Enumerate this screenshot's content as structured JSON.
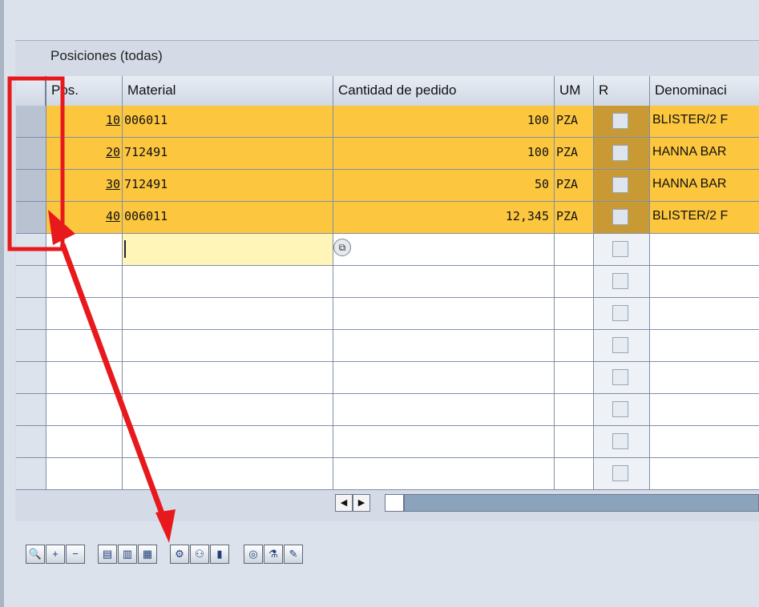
{
  "panel": {
    "title": "Posiciones (todas)"
  },
  "grid": {
    "headers": {
      "pos": "Pos.",
      "material": "Material",
      "quantity": "Cantidad de pedido",
      "um": "UM",
      "r": "R",
      "denomination": "Denominaci"
    },
    "rows": [
      {
        "pos": "10",
        "material": "006011",
        "quantity": "100",
        "um": "PZA",
        "denomination": "BLISTER/2 F"
      },
      {
        "pos": "20",
        "material": "712491",
        "quantity": "100",
        "um": "PZA",
        "denomination": "HANNA BAR"
      },
      {
        "pos": "30",
        "material": "712491",
        "quantity": "50",
        "um": "PZA",
        "denomination": "HANNA BAR"
      },
      {
        "pos": "40",
        "material": "006011",
        "quantity": "12,345",
        "um": "PZA",
        "denomination": "BLISTER/2 F"
      }
    ],
    "empty_rows": 8,
    "f4_icon": "value-help-icon"
  },
  "scrollbar": {
    "left_arrow": "◀",
    "right_arrow": "▶"
  },
  "toolbar": {
    "buttons": [
      {
        "name": "details-icon",
        "glyph": "🔍"
      },
      {
        "name": "insert-row-icon",
        "glyph": "+"
      },
      {
        "name": "delete-row-icon",
        "glyph": "−"
      },
      {
        "name": "select-all-icon",
        "glyph": "▤"
      },
      {
        "name": "select-block-icon",
        "glyph": "▥"
      },
      {
        "name": "deselect-all-icon",
        "glyph": "▦"
      },
      {
        "name": "default-values-icon",
        "glyph": "⚙"
      },
      {
        "name": "copy-icon",
        "glyph": "⚇"
      },
      {
        "name": "conditions-icon",
        "glyph": "▮"
      },
      {
        "name": "change-all-icon",
        "glyph": "◎"
      },
      {
        "name": "materials-icon",
        "glyph": "⚗"
      },
      {
        "name": "edit-icon",
        "glyph": "✎"
      }
    ]
  },
  "colors": {
    "row_highlight": "#fcc63f",
    "annotation": "#e8191c"
  }
}
